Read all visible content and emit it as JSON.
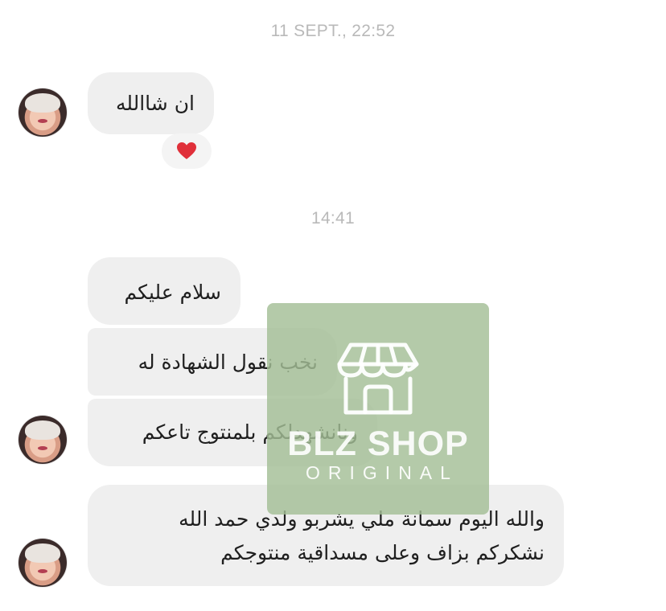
{
  "conversation": {
    "timestamp_1": "11 SEPT., 22:52",
    "timestamp_2": "14:41",
    "messages": [
      {
        "text": "ان شاالله",
        "reaction": "heart"
      },
      {
        "text": "سلام عليكم"
      },
      {
        "text": "نخب نقول الشهادة له"
      },
      {
        "text": "ونانشهدلكم بلمنتوج تاعكم"
      },
      {
        "lines": [
          "والله اليوم سمانة ملي يشربو ولدي حمد الله",
          "نشكركم بزاف وعلى مسداقية منتوجكم"
        ]
      }
    ]
  },
  "watermark": {
    "brand": "BLZ SHOP",
    "subtitle": "ORIGINAL",
    "icon": "storefront-icon"
  },
  "colors": {
    "bubble": "#efefef",
    "timestamp": "#b9b9b9",
    "heart": "#e0303a",
    "watermark_bg": "#a4be96"
  }
}
